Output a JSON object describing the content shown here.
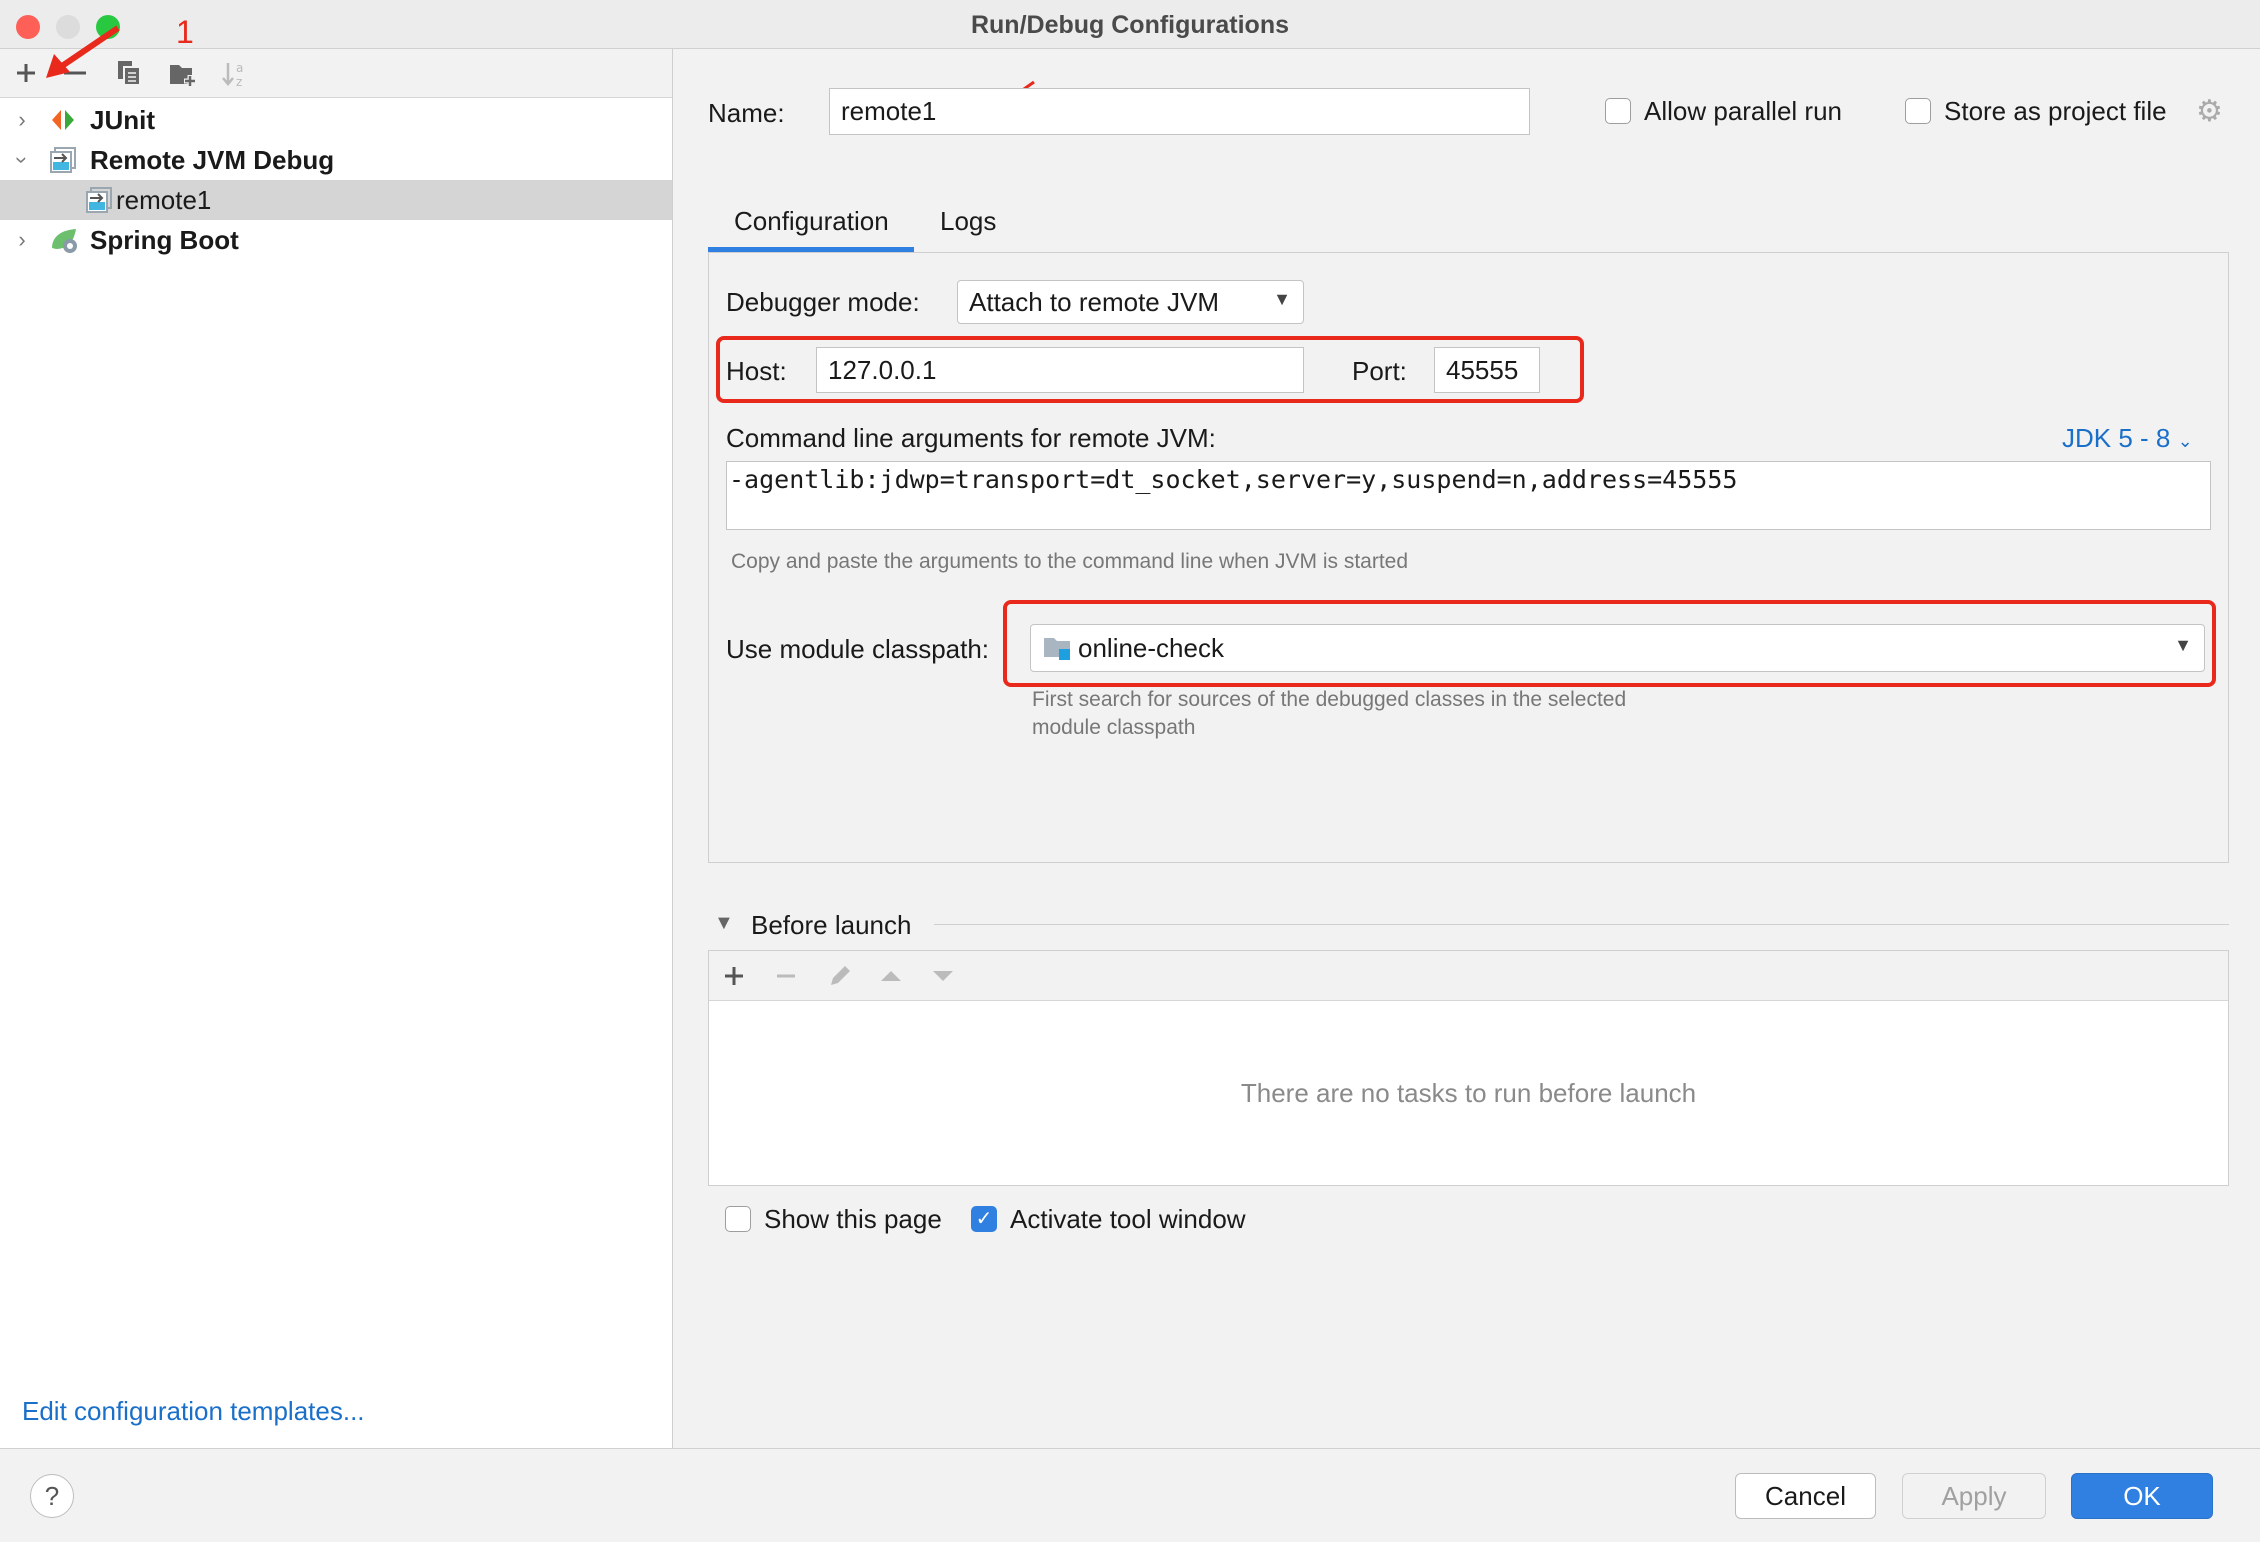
{
  "window": {
    "title": "Run/Debug Configurations"
  },
  "annotation": {
    "step_label": "1",
    "color": "#e8291b"
  },
  "toolbar": {
    "icons": [
      "plus-icon",
      "minus-icon",
      "copy-icon",
      "new-folder-icon",
      "sort-alpha-icon"
    ]
  },
  "tree": [
    {
      "label": "JUnit",
      "expanded": false,
      "icon": "junit-icon"
    },
    {
      "label": "Remote JVM Debug",
      "expanded": true,
      "icon": "remote-debug-icon"
    },
    {
      "label": "remote1",
      "selected": true,
      "icon": "remote-debug-icon"
    },
    {
      "label": "Spring Boot",
      "expanded": false,
      "icon": "spring-boot-icon"
    }
  ],
  "edit_templates_link": "Edit configuration templates...",
  "name": {
    "label": "Name:",
    "value": "remote1"
  },
  "allow_parallel": {
    "label": "Allow parallel run",
    "checked": false
  },
  "store_project": {
    "label": "Store as project file",
    "checked": false
  },
  "tabs": [
    {
      "label": "Configuration",
      "active": true
    },
    {
      "label": "Logs",
      "active": false
    }
  ],
  "config": {
    "debugger_mode_label": "Debugger mode:",
    "debugger_mode_value": "Attach to remote JVM",
    "host_label": "Host:",
    "host_value": "127.0.0.1",
    "port_label": "Port:",
    "port_value": "45555",
    "cmd_label": "Command line arguments for remote JVM:",
    "jdk_link": "JDK 5 - 8",
    "cmd_value": "-agentlib:jdwp=transport=dt_socket,server=y,suspend=n,address=45555",
    "cmd_hint": "Copy and paste the arguments to the command line when JVM is started",
    "module_label": "Use module classpath:",
    "module_value": "online-check",
    "module_hint1": "First search for sources of the debugged classes in the selected",
    "module_hint2": "module classpath"
  },
  "before_launch": {
    "title": "Before launch",
    "empty": "There are no tasks to run before launch"
  },
  "show_page": {
    "label": "Show this page",
    "checked": false
  },
  "activate_tool": {
    "label": "Activate tool window",
    "checked": true
  },
  "buttons": {
    "cancel": "Cancel",
    "apply": "Apply",
    "ok": "OK",
    "help": "?"
  },
  "colors": {
    "accent": "#2f80e0",
    "link": "#1a6fc9",
    "annotation": "#e8291b"
  }
}
